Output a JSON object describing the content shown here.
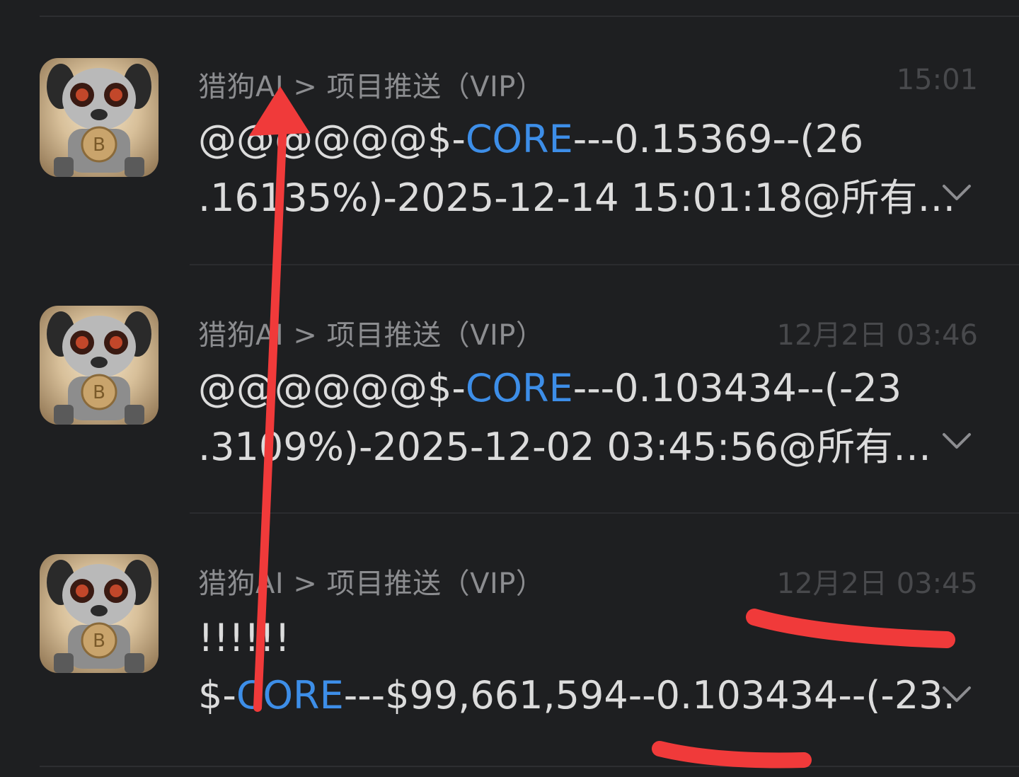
{
  "accent_color": "#3d8ee8",
  "annotation_color": "#f03a3a",
  "messages": [
    {
      "sender": "猎狗AI > 项目推送（VIP）",
      "time": "15:01",
      "line1_pre": "@@@@@@$-",
      "line1_hl": "CORE",
      "line1_post": "---0.15369--(26",
      "line2": ".16135%)-2025-12-14 15:01:18@所有…",
      "avatar_icon": "robot-dog-bitcoin-avatar",
      "expand_icon": "chevron-down-icon"
    },
    {
      "sender": "猎狗AI > 项目推送（VIP）",
      "time": "12月2日 03:46",
      "line1_pre": "@@@@@@$-",
      "line1_hl": "CORE",
      "line1_post": "---0.103434--(-23",
      "line2": ".3109%)-2025-12-02 03:45:56@所有…",
      "avatar_icon": "robot-dog-bitcoin-avatar",
      "expand_icon": "chevron-down-icon"
    },
    {
      "sender": "猎狗AI > 项目推送（VIP）",
      "time": "12月2日 03:45",
      "line1": "!!!!!!",
      "line2_pre": "$-",
      "line2_hl": "CORE",
      "line2_post": "---$99,661,594--0.103434--(-23.",
      "avatar_icon": "robot-dog-bitcoin-avatar",
      "expand_icon": "chevron-down-icon"
    }
  ]
}
